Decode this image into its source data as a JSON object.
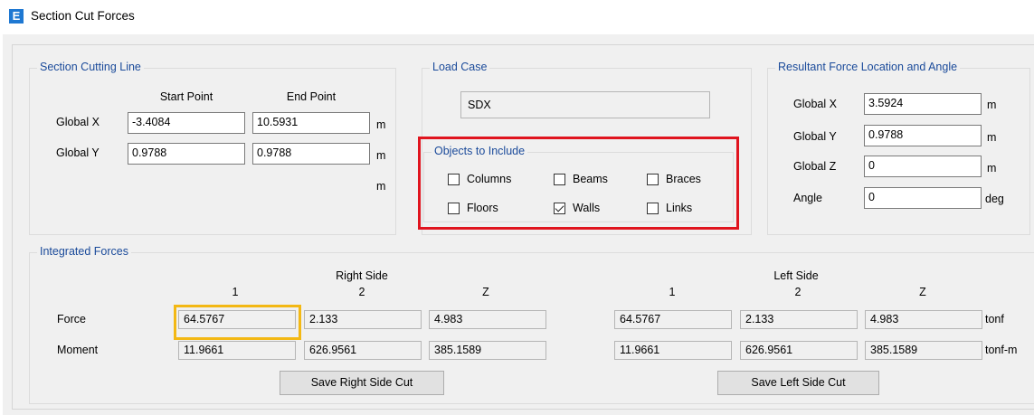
{
  "window": {
    "title": "Section Cut Forces",
    "icon_letter": "E"
  },
  "section_cutting_line": {
    "title": "Section Cutting Line",
    "start_header": "Start Point",
    "end_header": "End Point",
    "global_x_label": "Global  X",
    "global_y_label": "Global  Y",
    "start_x": "-3.4084",
    "end_x": "10.5931",
    "start_y": "0.9788",
    "end_y": "0.9788",
    "unit_x": "m",
    "unit_y": "m",
    "unit_extra": "m"
  },
  "load_case": {
    "title": "Load Case",
    "value": "SDX"
  },
  "objects": {
    "title": "Objects to Include",
    "columns": {
      "label": "Columns",
      "checked": false
    },
    "beams": {
      "label": "Beams",
      "checked": false
    },
    "braces": {
      "label": "Braces",
      "checked": false
    },
    "floors": {
      "label": "Floors",
      "checked": false
    },
    "walls": {
      "label": "Walls",
      "checked": true
    },
    "links": {
      "label": "Links",
      "checked": false
    }
  },
  "resultant": {
    "title": "Resultant Force Location and Angle",
    "gx_label": "Global  X",
    "gx_value": "3.5924",
    "gx_unit": "m",
    "gy_label": "Global  Y",
    "gy_value": "0.9788",
    "gy_unit": "m",
    "gz_label": "Global  Z",
    "gz_value": "0",
    "gz_unit": "m",
    "angle_label": "Angle",
    "angle_value": "0",
    "angle_unit": "deg"
  },
  "integrated": {
    "title": "Integrated Forces",
    "right_side_label": "Right Side",
    "left_side_label": "Left Side",
    "col_headers": [
      "1",
      "2",
      "Z"
    ],
    "force_label": "Force",
    "moment_label": "Moment",
    "right_force": [
      "64.5767",
      "2.133",
      "4.983"
    ],
    "right_moment": [
      "11.9661",
      "626.9561",
      "385.1589"
    ],
    "left_force": [
      "64.5767",
      "2.133",
      "4.983"
    ],
    "left_moment": [
      "11.9661",
      "626.9561",
      "385.1589"
    ],
    "force_unit": "tonf",
    "moment_unit": "tonf-m",
    "save_right_label": "Save Right Side Cut",
    "save_left_label": "Save Left Side Cut"
  },
  "highlight_colors": {
    "objects_box": "#e0141e",
    "force_cell": "#f3b814"
  }
}
